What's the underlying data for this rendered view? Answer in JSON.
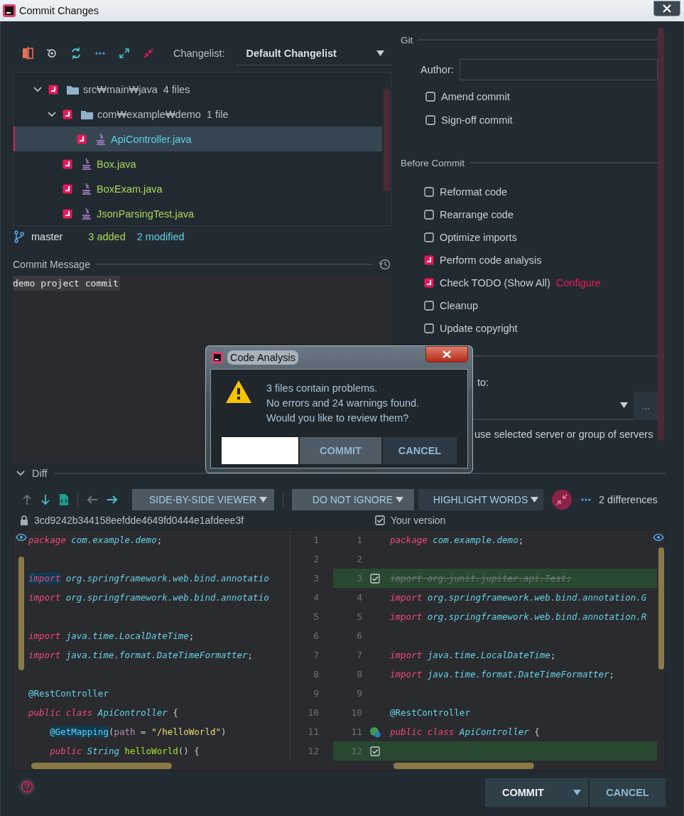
{
  "window": {
    "title": "Commit Changes"
  },
  "toolbar": {
    "changelist_label": "Changelist:",
    "changelist": "Default Changelist"
  },
  "tree": [
    {
      "name": "src₩main₩java",
      "count": "4 files",
      "checked": true,
      "expanded": true,
      "selected": false,
      "children": [
        {
          "name": "com₩example₩demo",
          "count": "1 file",
          "checked": true,
          "expanded": true,
          "selected": false,
          "children": [
            {
              "name": "ApiController.java",
              "kind": "modified",
              "checked": true,
              "selected": true
            }
          ]
        },
        {
          "name": "Box.java",
          "kind": "added",
          "checked": true,
          "selected": false
        },
        {
          "name": "BoxExam.java",
          "kind": "added",
          "checked": true,
          "selected": false
        },
        {
          "name": "JsonParsingTest.java",
          "kind": "added",
          "checked": true,
          "selected": false
        }
      ]
    }
  ],
  "branch": {
    "name": "master",
    "added": "3 added",
    "modified": "2 modified"
  },
  "commit_message": {
    "label": "Commit Message",
    "value": "demo project commit"
  },
  "git": {
    "title": "Git",
    "author_label": "Author:",
    "options": [
      {
        "label": "Amend commit",
        "checked": false
      },
      {
        "label": "Sign-off commit",
        "checked": false
      }
    ]
  },
  "before_commit": {
    "title": "Before Commit",
    "options": [
      {
        "label": "Reformat code",
        "checked": false
      },
      {
        "label": "Rearrange code",
        "checked": false
      },
      {
        "label": "Optimize imports",
        "checked": false
      },
      {
        "label": "Perform code analysis",
        "checked": true
      },
      {
        "label": "Check TODO (Show All)",
        "checked": true,
        "link": "Configure"
      },
      {
        "label": "Cleanup",
        "checked": false
      },
      {
        "label": "Update copyright",
        "checked": false
      }
    ]
  },
  "upload": {
    "label": "to:",
    "note": "use selected server or group of servers",
    "more": "..."
  },
  "diff": {
    "title": "Diff",
    "viewer": "SIDE-BY-SIDE VIEWER",
    "ignore": "DO NOT IGNORE",
    "highlight": "HIGHLIGHT WORDS",
    "differences": "2 differences",
    "left_title": "3cd9242b344158eefdde4649fd0444e1afdeee3f",
    "right_title": "Your version",
    "right_checked": true,
    "rows": [
      {
        "left_num": "1",
        "right_num": "1",
        "kind": "same",
        "left": [
          {
            "text": "package",
            "kind": "keyword"
          },
          {
            "text": " com.example.demo",
            "kind": "type"
          },
          {
            "text": ";",
            "kind": "plain"
          }
        ],
        "right": [
          {
            "text": "package",
            "kind": "keyword"
          },
          {
            "text": " com.example.demo",
            "kind": "type"
          },
          {
            "text": ";",
            "kind": "plain"
          }
        ]
      },
      {
        "left_num": "2",
        "right_num": "2",
        "kind": "same"
      },
      {
        "left_num": "3",
        "right_num": "3",
        "kind": "inserted",
        "left": [
          {
            "text": "import",
            "kind": "keyword_hl"
          },
          {
            "text": " org.springframework.web.bind.annotatio",
            "kind": "type"
          }
        ],
        "right": [
          {
            "text": "import org.junit.jupiter.api.Test;",
            "kind": "unused"
          }
        ]
      },
      {
        "left_num": "4",
        "right_num": "4",
        "kind": "same",
        "left": [
          {
            "text": "import",
            "kind": "keyword"
          },
          {
            "text": " org.springframework.web.bind.annotatio",
            "kind": "type"
          }
        ],
        "right": [
          {
            "text": "import",
            "kind": "keyword"
          },
          {
            "text": " org.springframework.web.bind.annotation.G",
            "kind": "type"
          }
        ]
      },
      {
        "left_num": "5",
        "right_num": "5",
        "kind": "same",
        "right": [
          {
            "text": "import",
            "kind": "keyword"
          },
          {
            "text": " org.springframework.web.bind.annotation.R",
            "kind": "type"
          }
        ]
      },
      {
        "left_num": "6",
        "right_num": "6",
        "kind": "same",
        "left": [
          {
            "text": "import",
            "kind": "keyword"
          },
          {
            "text": " java.time.LocalDateTime",
            "kind": "type"
          },
          {
            "text": ";",
            "kind": "plain"
          }
        ]
      },
      {
        "left_num": "7",
        "right_num": "7",
        "kind": "same",
        "left": [
          {
            "text": "import",
            "kind": "keyword"
          },
          {
            "text": " java.time.format.DateTimeFormatter",
            "kind": "type"
          },
          {
            "text": ";",
            "kind": "plain"
          }
        ],
        "right": [
          {
            "text": "import",
            "kind": "keyword"
          },
          {
            "text": " java.time.LocalDateTime",
            "kind": "type"
          },
          {
            "text": ";",
            "kind": "plain"
          }
        ]
      },
      {
        "left_num": "8",
        "right_num": "8",
        "kind": "same",
        "right": [
          {
            "text": "import",
            "kind": "keyword"
          },
          {
            "text": " java.time.format.DateTimeFormatter",
            "kind": "type"
          },
          {
            "text": ";",
            "kind": "plain"
          }
        ]
      },
      {
        "left_num": "9",
        "right_num": "9",
        "kind": "same",
        "left": [
          {
            "text": "@RestController",
            "kind": "annotation"
          }
        ]
      },
      {
        "left_num": "10",
        "right_num": "10",
        "kind": "same",
        "left": [
          {
            "text": "public class",
            "kind": "keyword"
          },
          {
            "text": " ApiController",
            "kind": "type"
          },
          {
            "text": " {",
            "kind": "plain"
          }
        ],
        "right": [
          {
            "text": "@RestController",
            "kind": "annotation"
          }
        ]
      },
      {
        "left_num": "11",
        "right_num": "11",
        "kind": "bean",
        "indented": true,
        "left": [
          {
            "text": "@GetMapping",
            "kind": "annotation_hl"
          },
          {
            "text": "(",
            "kind": "plain"
          },
          {
            "text": "path",
            "kind": "param"
          },
          {
            "text": " = ",
            "kind": "plain"
          },
          {
            "text": "\"/helloWorld\"",
            "kind": "string"
          },
          {
            "text": ")",
            "kind": "plain"
          }
        ],
        "right": [
          {
            "text": "public class",
            "kind": "keyword"
          },
          {
            "text": " ApiController",
            "kind": "type"
          },
          {
            "text": " {",
            "kind": "plain"
          }
        ]
      },
      {
        "left_num": "12",
        "right_num": "12",
        "kind": "inserted",
        "indented": true,
        "left": [
          {
            "text": "public",
            "kind": "keyword"
          },
          {
            "text": " String",
            "kind": "type"
          },
          {
            "text": " helloWorld",
            "kind": "method"
          },
          {
            "text": "() {",
            "kind": "plain"
          }
        ]
      }
    ]
  },
  "buttons": {
    "commit": "COMMIT",
    "cancel": "CANCEL"
  },
  "dialog": {
    "title": "Code Analysis",
    "lines": [
      "3 files contain problems.",
      "No errors and 24 warnings found.",
      "Would you like to review them?"
    ],
    "commit": "COMMIT",
    "cancel": "CANCEL"
  }
}
